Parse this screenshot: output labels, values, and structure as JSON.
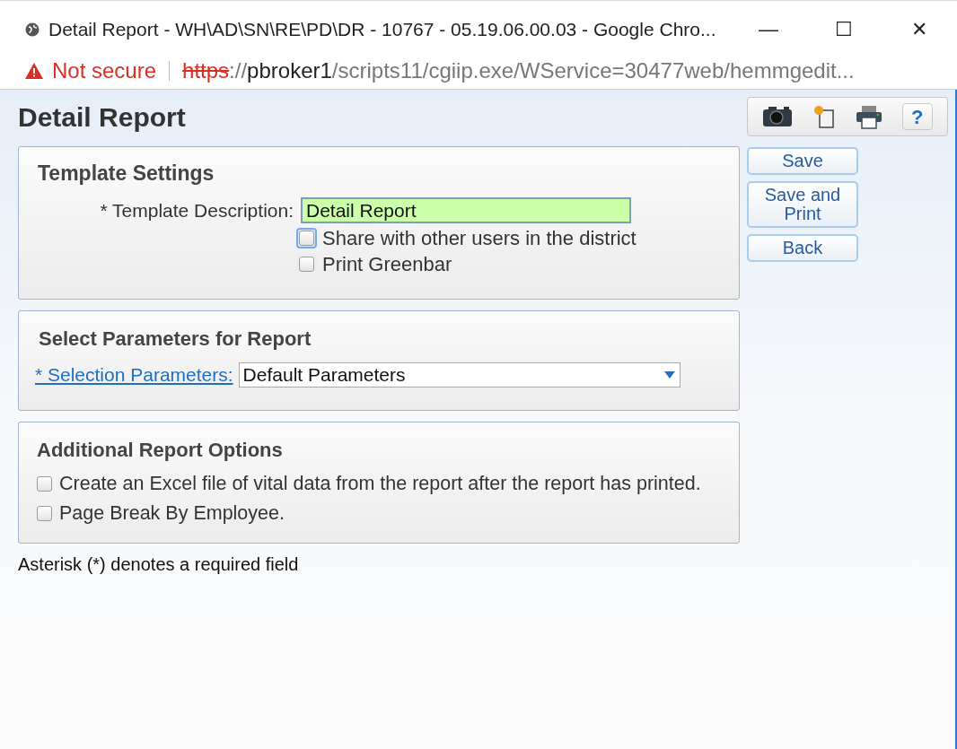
{
  "window": {
    "title": "Detail Report - WH\\AD\\SN\\RE\\PD\\DR - 10767 - 05.19.06.00.03 - Google Chro...",
    "controls": [
      "—",
      "☐",
      "✕"
    ]
  },
  "address_bar": {
    "security": "Not secure",
    "scheme": "https",
    "separator": "://",
    "host": "pbroker1",
    "path": "/scripts11/cgiip.exe/WService=30477web/hemmgedit..."
  },
  "page": {
    "title": "Detail Report",
    "toolbar": [
      {
        "kind": "camera"
      },
      {
        "kind": "new"
      },
      {
        "kind": "print"
      },
      {
        "kind": "help",
        "label": "?"
      }
    ],
    "buttons": [
      {
        "label": "Save"
      },
      {
        "label": "Save and Print"
      },
      {
        "label": "Back"
      }
    ],
    "template_settings": {
      "heading": "Template Settings",
      "description_label": "* Template Description:",
      "description_value": "Detail Report",
      "options": [
        {
          "label": "Share with other users in the district",
          "checked": false,
          "focused": true
        },
        {
          "label": "Print Greenbar",
          "checked": false,
          "focused": false
        }
      ]
    },
    "parameters": {
      "heading": "Select Parameters for Report",
      "link": "* Selection Parameters:",
      "value": "Default Parameters"
    },
    "additional_options": {
      "heading": "Additional Report Options",
      "options": [
        {
          "label": "Create an Excel file of vital data from the report after the report has printed.",
          "checked": false
        },
        {
          "label": "Page Break By Employee.",
          "checked": false
        }
      ]
    },
    "footnote": "Asterisk (*) denotes a required field"
  }
}
